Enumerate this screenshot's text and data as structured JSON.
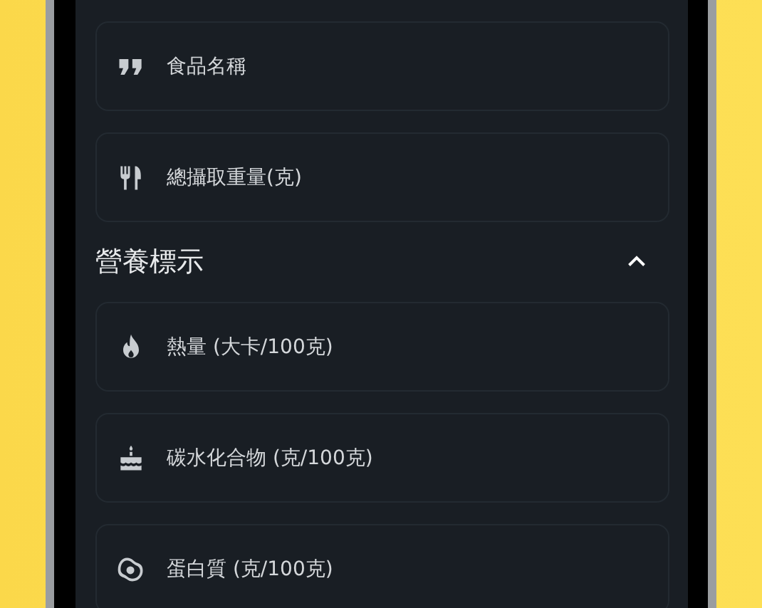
{
  "fields_top": [
    {
      "kind": "quote",
      "placeholder": "食品名稱"
    },
    {
      "kind": "cutlery",
      "placeholder": "總攝取重量(克)"
    }
  ],
  "nutrition_section": {
    "title": "營養標示",
    "expanded": true,
    "fields": [
      {
        "kind": "flame",
        "placeholder": "熱量 (大卡/100克)"
      },
      {
        "kind": "cake",
        "placeholder": "碳水化合物 (克/100克)"
      },
      {
        "kind": "egg",
        "placeholder": "蛋白質 (克/100克)"
      }
    ]
  }
}
